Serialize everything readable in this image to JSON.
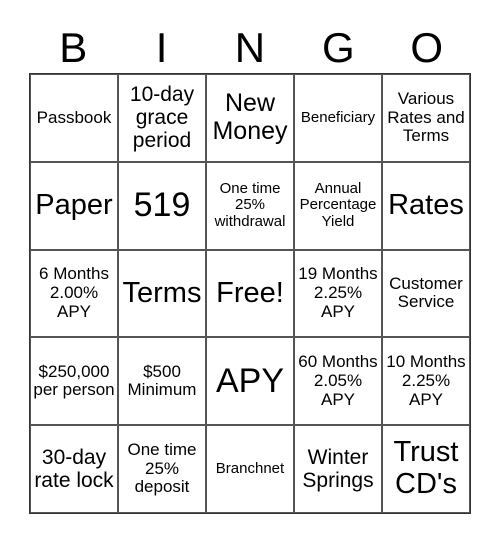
{
  "header": {
    "letters": [
      "B",
      "I",
      "N",
      "G",
      "O"
    ]
  },
  "cells": [
    [
      "Passbook",
      "10-day grace period",
      "New Money",
      "Beneficiary",
      "Various Rates and Terms"
    ],
    [
      "Paper",
      "519",
      "One time 25% withdrawal",
      "Annual Percentage Yield",
      "Rates"
    ],
    [
      "6 Months 2.00% APY",
      "Terms",
      "Free!",
      "19 Months 2.25% APY",
      "Customer Service"
    ],
    [
      "$250,000 per person",
      "$500 Minimum",
      "APY",
      "60 Months 2.05% APY",
      "10 Months 2.25% APY"
    ],
    [
      "30-day rate lock",
      "One time 25% deposit",
      "Branchnet",
      "Winter Springs",
      "Trust CD's"
    ]
  ]
}
